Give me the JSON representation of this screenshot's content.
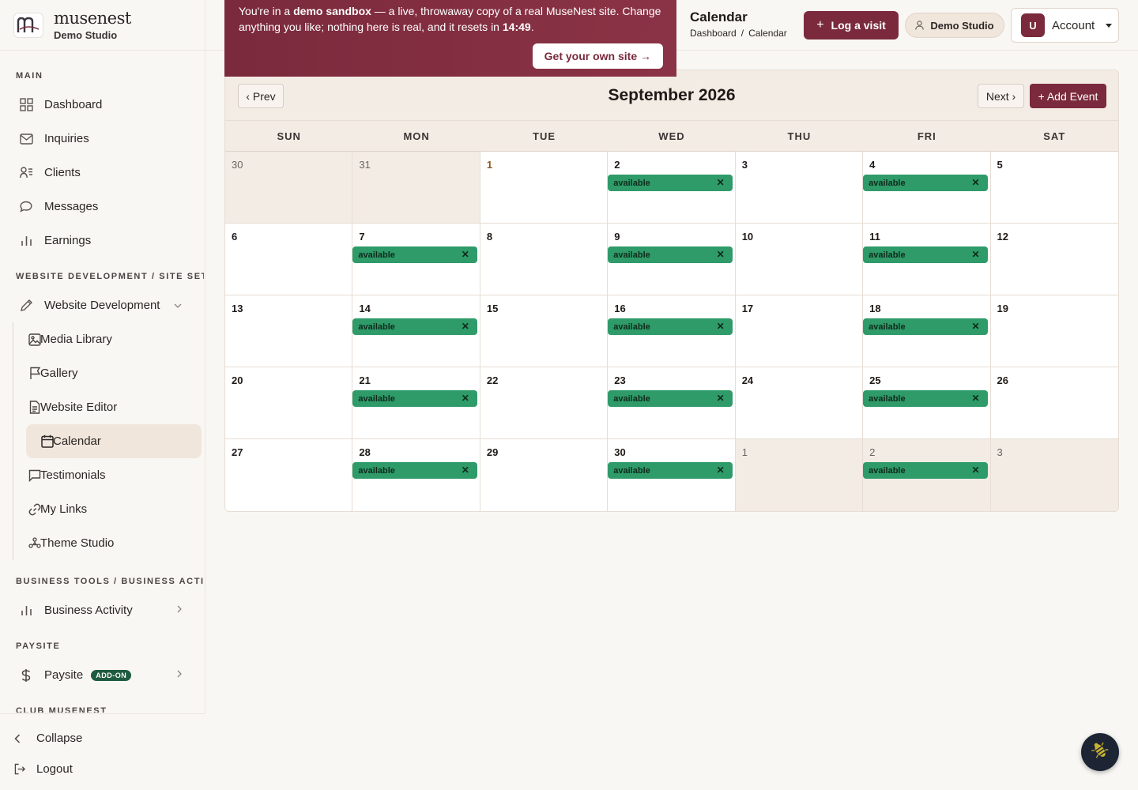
{
  "brand": {
    "name": "musenest",
    "sub": "Demo Studio",
    "accent": "#7a2a3c"
  },
  "sections": {
    "main": "MAIN",
    "website": "WEBSITE DEVELOPMENT / SITE SETUP",
    "business": "BUSINESS TOOLS / BUSINESS ACTIVITY",
    "paysite": "PAYSITE",
    "club": "CLUB MUSENEST"
  },
  "main_items": [
    {
      "label": "Dashboard",
      "icon": "grid-icon"
    },
    {
      "label": "Inquiries",
      "icon": "mail-icon"
    },
    {
      "label": "Clients",
      "icon": "users-icon"
    },
    {
      "label": "Messages",
      "icon": "chat-icon"
    },
    {
      "label": "Earnings",
      "icon": "bar-chart-icon"
    }
  ],
  "website_dev": {
    "label": "Website Development"
  },
  "website_sub": [
    {
      "label": "Media Library",
      "icon": "image-icon"
    },
    {
      "label": "Gallery",
      "icon": "flag-icon"
    },
    {
      "label": "Website Editor",
      "icon": "document-icon"
    },
    {
      "label": "Calendar",
      "icon": "calendar-icon",
      "active": true
    },
    {
      "label": "Testimonials",
      "icon": "chat-square-icon"
    },
    {
      "label": "My Links",
      "icon": "link-icon"
    },
    {
      "label": "Theme Studio",
      "icon": "palette-icon"
    }
  ],
  "business_activity": {
    "label": "Business Activity"
  },
  "paysite": {
    "label": "Paysite",
    "badge": "ADD-ON"
  },
  "bottom": {
    "collapse": "Collapse",
    "logout": "Logout"
  },
  "banner": {
    "text_pre": "You're in a ",
    "text_bold": "demo sandbox",
    "text_mid": " — a live, throwaway copy of a real MuseNest site. Change anything you like; nothing here is real, and it resets in ",
    "countdown": "14:49",
    "text_post": ".",
    "button": "Get your own site →"
  },
  "header": {
    "title": "Calendar",
    "breadcrumb": [
      "Dashboard",
      "Calendar"
    ],
    "log_visit": "Log a visit",
    "studio": "Demo Studio",
    "avatar": "U",
    "account": "Account"
  },
  "calendar": {
    "month": "September 2026",
    "prev": "‹ Prev",
    "next": "Next ›",
    "add_event": "+ Add Event",
    "weekdays": [
      "SUN",
      "MON",
      "TUE",
      "WED",
      "THU",
      "FRI",
      "SAT"
    ],
    "event_label": "available",
    "event_color": "#2e9b69",
    "weeks": [
      [
        {
          "n": "30",
          "m": true
        },
        {
          "n": "31",
          "m": true
        },
        {
          "n": "1",
          "today": true
        },
        {
          "n": "2",
          "e": true
        },
        {
          "n": "3"
        },
        {
          "n": "4",
          "e": true
        },
        {
          "n": "5"
        }
      ],
      [
        {
          "n": "6"
        },
        {
          "n": "7",
          "e": true
        },
        {
          "n": "8"
        },
        {
          "n": "9",
          "e": true
        },
        {
          "n": "10"
        },
        {
          "n": "11",
          "e": true
        },
        {
          "n": "12"
        }
      ],
      [
        {
          "n": "13"
        },
        {
          "n": "14",
          "e": true
        },
        {
          "n": "15"
        },
        {
          "n": "16",
          "e": true
        },
        {
          "n": "17"
        },
        {
          "n": "18",
          "e": true
        },
        {
          "n": "19"
        }
      ],
      [
        {
          "n": "20"
        },
        {
          "n": "21",
          "e": true
        },
        {
          "n": "22"
        },
        {
          "n": "23",
          "e": true
        },
        {
          "n": "24"
        },
        {
          "n": "25",
          "e": true
        },
        {
          "n": "26"
        }
      ],
      [
        {
          "n": "27"
        },
        {
          "n": "28",
          "e": true
        },
        {
          "n": "29"
        },
        {
          "n": "30",
          "e": true
        },
        {
          "n": "1",
          "m": true
        },
        {
          "n": "2",
          "m": true,
          "e": true
        },
        {
          "n": "3",
          "m": true
        }
      ]
    ]
  }
}
